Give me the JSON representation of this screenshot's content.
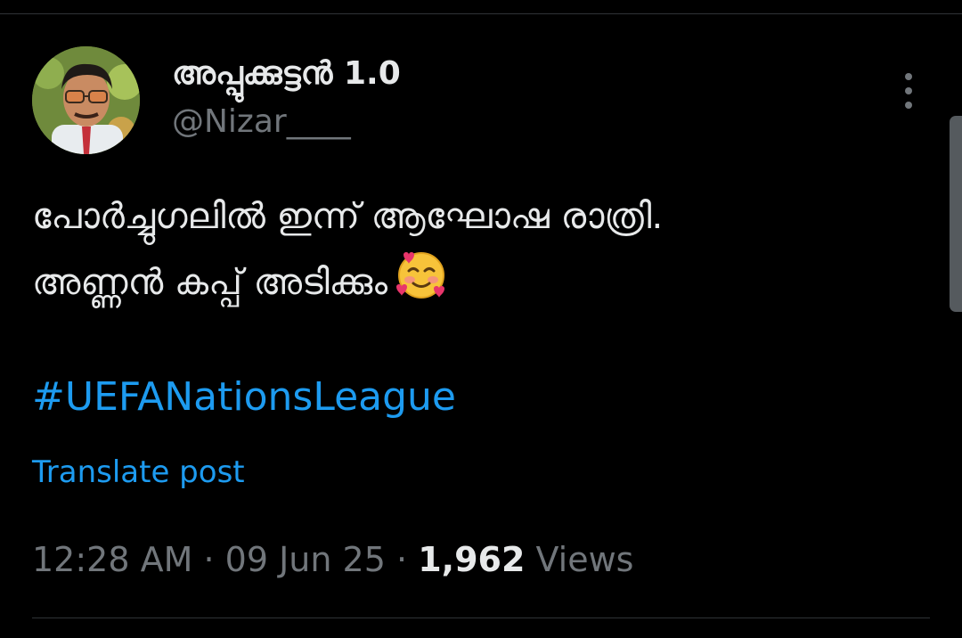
{
  "author": {
    "display_name": "അപ്പുക്കുട്ടൻ 1.0",
    "handle": "@Nizar____"
  },
  "tweet": {
    "line1": "പോർച്ചുഗലിൽ ഇന്ന് ആഘോഷ രാത്രി.",
    "line2": "അണ്ണൻ കപ്പ് അടിക്കും",
    "emoji": "smiling-face-with-hearts",
    "hashtag": "#UEFANationsLeague"
  },
  "translate_label": "Translate post",
  "meta": {
    "time": "12:28 AM",
    "separator": "·",
    "date": "09 Jun 25",
    "views_count": "1,962",
    "views_label": "Views"
  },
  "colors": {
    "background": "#000000",
    "primary_text": "#e7e9ea",
    "secondary_text": "#71767b",
    "link": "#1d9bf0",
    "divider": "#2f3336"
  }
}
